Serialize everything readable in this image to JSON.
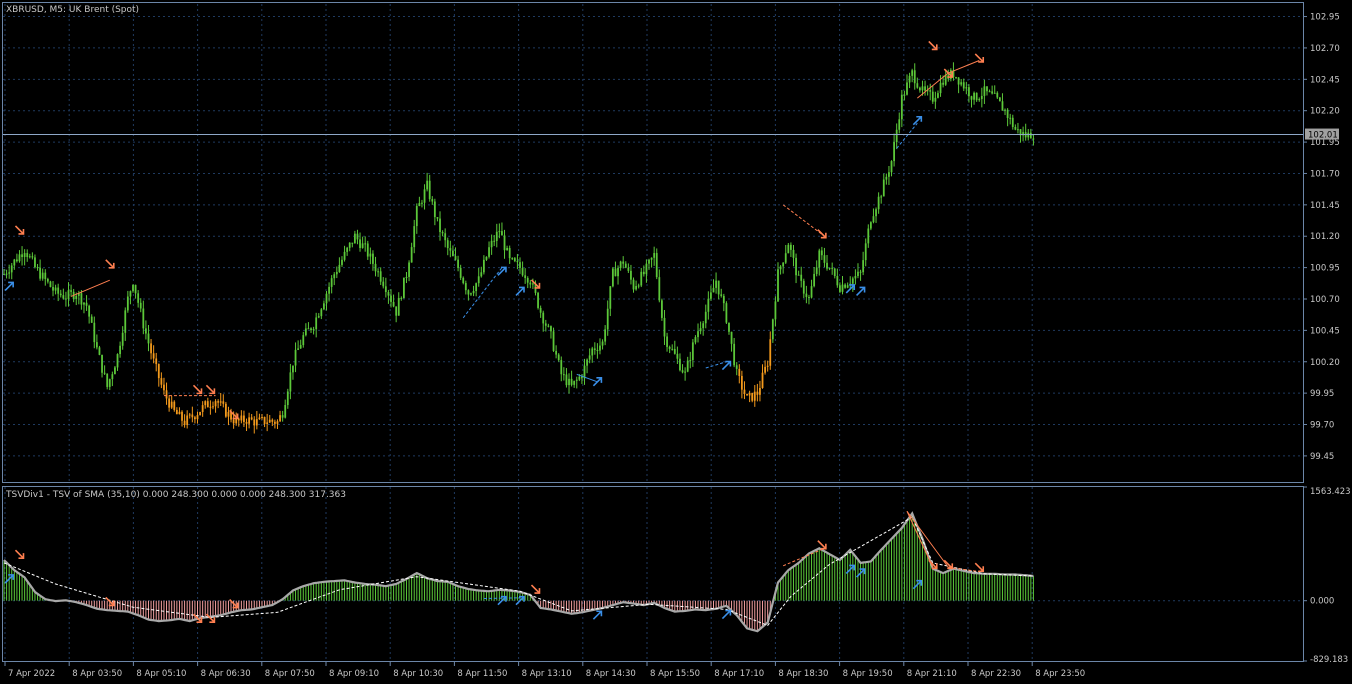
{
  "window": {
    "main_title": "XBRUSD, M5:  UK Brent (Spot)",
    "indicator_title": "TSVDiv1 - TSV of SMA (35,10) 0.000 248.300 0.000 0.000 248.300 317.363"
  },
  "colors": {
    "background": "#000000",
    "grid": "#1f3a5f",
    "frame": "#6c86a8",
    "candle_green": "#5cc839",
    "candle_orange": "#f39a1c",
    "histogram_green": "#5cc839",
    "histogram_red": "#f3a0a0",
    "tsv_line": "#a8a8a8",
    "signal_line": "#ffffff",
    "bear_arrow": "#ff7f50",
    "bull_arrow": "#3a8fe8",
    "price_line": "#8fa8c8"
  },
  "price_tag": "102.01",
  "chart_data": [
    {
      "type": "candlestick",
      "ylim": [
        99.25,
        103.05
      ],
      "y_ticks": [
        "102.95",
        "102.70",
        "102.45",
        "102.20",
        "101.95",
        "101.70",
        "101.45",
        "101.20",
        "100.95",
        "100.70",
        "100.45",
        "100.20",
        "99.95",
        "99.70",
        "99.45"
      ],
      "current_price": 102.01,
      "x_ticks": [
        "7 Apr 2022",
        "8 Apr 03:50",
        "8 Apr 05:10",
        "8 Apr 06:30",
        "8 Apr 07:50",
        "8 Apr 09:10",
        "8 Apr 10:30",
        "8 Apr 11:50",
        "8 Apr 13:10",
        "8 Apr 14:30",
        "8 Apr 15:50",
        "8 Apr 17:10",
        "8 Apr 18:30",
        "8 Apr 19:50",
        "8 Apr 21:10",
        "8 Apr 22:30",
        "8 Apr 23:50"
      ],
      "close_path": [
        [
          0,
          100.9
        ],
        [
          4,
          101.0
        ],
        [
          8,
          101.1
        ],
        [
          12,
          100.95
        ],
        [
          16,
          100.85
        ],
        [
          20,
          100.75
        ],
        [
          24,
          100.72
        ],
        [
          28,
          100.75
        ],
        [
          32,
          100.65
        ],
        [
          36,
          100.3
        ],
        [
          40,
          100.0
        ],
        [
          44,
          100.25
        ],
        [
          48,
          100.7
        ],
        [
          50,
          100.85
        ],
        [
          54,
          100.5
        ],
        [
          58,
          100.2
        ],
        [
          62,
          99.95
        ],
        [
          66,
          99.8
        ],
        [
          70,
          99.72
        ],
        [
          74,
          99.78
        ],
        [
          78,
          99.85
        ],
        [
          82,
          99.9
        ],
        [
          86,
          99.8
        ],
        [
          90,
          99.72
        ],
        [
          94,
          99.74
        ],
        [
          98,
          99.72
        ],
        [
          102,
          99.73
        ],
        [
          106,
          99.72
        ],
        [
          108,
          99.8
        ],
        [
          112,
          100.2
        ],
        [
          116,
          100.4
        ],
        [
          120,
          100.5
        ],
        [
          124,
          100.7
        ],
        [
          128,
          100.9
        ],
        [
          132,
          101.05
        ],
        [
          136,
          101.2
        ],
        [
          140,
          101.1
        ],
        [
          144,
          100.95
        ],
        [
          148,
          100.8
        ],
        [
          152,
          100.6
        ],
        [
          156,
          100.9
        ],
        [
          160,
          101.4
        ],
        [
          164,
          101.6
        ],
        [
          168,
          101.3
        ],
        [
          172,
          101.1
        ],
        [
          176,
          100.95
        ],
        [
          180,
          100.75
        ],
        [
          184,
          100.85
        ],
        [
          188,
          101.1
        ],
        [
          192,
          101.25
        ],
        [
          196,
          101.0
        ],
        [
          200,
          100.95
        ],
        [
          204,
          100.85
        ],
        [
          208,
          100.6
        ],
        [
          212,
          100.4
        ],
        [
          216,
          100.1
        ],
        [
          220,
          100.0
        ],
        [
          224,
          100.1
        ],
        [
          228,
          100.3
        ],
        [
          232,
          100.35
        ],
        [
          236,
          100.9
        ],
        [
          240,
          101.0
        ],
        [
          244,
          100.8
        ],
        [
          248,
          100.9
        ],
        [
          252,
          101.05
        ],
        [
          256,
          100.4
        ],
        [
          260,
          100.25
        ],
        [
          264,
          100.1
        ],
        [
          268,
          100.4
        ],
        [
          272,
          100.6
        ],
        [
          276,
          100.85
        ],
        [
          280,
          100.55
        ],
        [
          284,
          100.1
        ],
        [
          288,
          99.9
        ],
        [
          292,
          99.95
        ],
        [
          296,
          100.2
        ],
        [
          300,
          100.9
        ],
        [
          304,
          101.15
        ],
        [
          308,
          100.85
        ],
        [
          312,
          100.7
        ],
        [
          316,
          101.05
        ],
        [
          320,
          100.95
        ],
        [
          324,
          100.8
        ],
        [
          328,
          100.85
        ],
        [
          332,
          100.9
        ],
        [
          336,
          101.35
        ],
        [
          340,
          101.55
        ],
        [
          344,
          101.8
        ],
        [
          348,
          102.3
        ],
        [
          352,
          102.5
        ],
        [
          356,
          102.35
        ],
        [
          360,
          102.3
        ],
        [
          364,
          102.45
        ],
        [
          368,
          102.5
        ],
        [
          372,
          102.4
        ],
        [
          376,
          102.3
        ],
        [
          380,
          102.35
        ],
        [
          384,
          102.3
        ],
        [
          388,
          102.2
        ],
        [
          392,
          102.05
        ],
        [
          396,
          102.0
        ],
        [
          399,
          102.02
        ]
      ],
      "orange_segments": [
        [
          57,
          107
        ],
        [
          285,
          297
        ]
      ],
      "marks": [
        {
          "type": "bear",
          "x": 6,
          "y": 101.25
        },
        {
          "type": "bear",
          "x": 41,
          "y": 100.98
        },
        {
          "type": "bear",
          "x": 75,
          "y": 99.98
        },
        {
          "type": "bear",
          "x": 80,
          "y": 99.98
        },
        {
          "type": "bear",
          "x": 89,
          "y": 99.78
        },
        {
          "type": "bear",
          "x": 206,
          "y": 100.82
        },
        {
          "type": "bear",
          "x": 317,
          "y": 101.22
        },
        {
          "type": "bear",
          "x": 360,
          "y": 102.72
        },
        {
          "type": "bear",
          "x": 366,
          "y": 102.5
        },
        {
          "type": "bear",
          "x": 378,
          "y": 102.62
        },
        {
          "type": "bull",
          "x": 2,
          "y": 100.8
        },
        {
          "type": "bull",
          "x": 193,
          "y": 100.92
        },
        {
          "type": "bull",
          "x": 200,
          "y": 100.76
        },
        {
          "type": "bull",
          "x": 230,
          "y": 100.04
        },
        {
          "type": "bull",
          "x": 280,
          "y": 100.17
        },
        {
          "type": "bull",
          "x": 328,
          "y": 100.78
        },
        {
          "type": "bull",
          "x": 332,
          "y": 100.76
        },
        {
          "type": "bull",
          "x": 354,
          "y": 102.12
        }
      ],
      "div_lines": [
        {
          "type": "bear",
          "x1": 26,
          "y1": 100.72,
          "x2": 41,
          "y2": 100.85,
          "dashed": false
        },
        {
          "type": "bear",
          "x1": 62,
          "y1": 99.93,
          "x2": 82,
          "y2": 99.93,
          "dashed": true
        },
        {
          "type": "bear",
          "x1": 302,
          "y1": 101.45,
          "x2": 318,
          "y2": 101.2,
          "dashed": true
        },
        {
          "type": "bear",
          "x1": 354,
          "y1": 102.3,
          "x2": 366,
          "y2": 102.5,
          "dashed": false
        },
        {
          "type": "bear",
          "x1": 366,
          "y1": 102.5,
          "x2": 378,
          "y2": 102.6,
          "dashed": false
        },
        {
          "type": "bull",
          "x1": 178,
          "y1": 100.55,
          "x2": 193,
          "y2": 100.95,
          "dashed": true
        },
        {
          "type": "bull",
          "x1": 222,
          "y1": 100.1,
          "x2": 230,
          "y2": 100.04,
          "dashed": false
        },
        {
          "type": "bull",
          "x1": 272,
          "y1": 100.15,
          "x2": 280,
          "y2": 100.2,
          "dashed": true
        },
        {
          "type": "bull",
          "x1": 346,
          "y1": 101.9,
          "x2": 354,
          "y2": 102.1,
          "dashed": true
        }
      ]
    },
    {
      "type": "bar",
      "ylim": [
        -829.183,
        1563.423
      ],
      "y_ticks": [
        "1563.423",
        "0.000",
        "-829.183"
      ],
      "tsv_path": [
        [
          0,
          560
        ],
        [
          4,
          420
        ],
        [
          8,
          320
        ],
        [
          12,
          120
        ],
        [
          16,
          20
        ],
        [
          20,
          -5
        ],
        [
          24,
          5
        ],
        [
          28,
          -20
        ],
        [
          32,
          -60
        ],
        [
          36,
          -110
        ],
        [
          40,
          -130
        ],
        [
          44,
          -140
        ],
        [
          48,
          -150
        ],
        [
          52,
          -200
        ],
        [
          56,
          -260
        ],
        [
          60,
          -280
        ],
        [
          64,
          -270
        ],
        [
          68,
          -250
        ],
        [
          72,
          -280
        ],
        [
          76,
          -240
        ],
        [
          80,
          -220
        ],
        [
          84,
          -200
        ],
        [
          88,
          -160
        ],
        [
          92,
          -130
        ],
        [
          96,
          -120
        ],
        [
          100,
          -90
        ],
        [
          104,
          -60
        ],
        [
          108,
          20
        ],
        [
          112,
          140
        ],
        [
          116,
          200
        ],
        [
          120,
          240
        ],
        [
          124,
          260
        ],
        [
          128,
          270
        ],
        [
          132,
          280
        ],
        [
          136,
          250
        ],
        [
          140,
          230
        ],
        [
          144,
          220
        ],
        [
          148,
          200
        ],
        [
          152,
          230
        ],
        [
          156,
          300
        ],
        [
          160,
          380
        ],
        [
          164,
          310
        ],
        [
          168,
          270
        ],
        [
          172,
          260
        ],
        [
          176,
          200
        ],
        [
          180,
          160
        ],
        [
          184,
          140
        ],
        [
          188,
          130
        ],
        [
          192,
          150
        ],
        [
          196,
          140
        ],
        [
          200,
          120
        ],
        [
          204,
          80
        ],
        [
          208,
          -100
        ],
        [
          212,
          -120
        ],
        [
          216,
          -150
        ],
        [
          220,
          -180
        ],
        [
          224,
          -160
        ],
        [
          228,
          -130
        ],
        [
          232,
          -100
        ],
        [
          236,
          -60
        ],
        [
          240,
          -20
        ],
        [
          244,
          -40
        ],
        [
          248,
          -60
        ],
        [
          252,
          -30
        ],
        [
          256,
          -100
        ],
        [
          260,
          -150
        ],
        [
          264,
          -140
        ],
        [
          268,
          -120
        ],
        [
          272,
          -130
        ],
        [
          276,
          -110
        ],
        [
          280,
          -70
        ],
        [
          284,
          -200
        ],
        [
          288,
          -380
        ],
        [
          292,
          -420
        ],
        [
          296,
          -300
        ],
        [
          300,
          250
        ],
        [
          304,
          420
        ],
        [
          308,
          520
        ],
        [
          312,
          650
        ],
        [
          316,
          720
        ],
        [
          320,
          640
        ],
        [
          324,
          560
        ],
        [
          328,
          700
        ],
        [
          332,
          520
        ],
        [
          336,
          540
        ],
        [
          340,
          700
        ],
        [
          344,
          850
        ],
        [
          348,
          1000
        ],
        [
          352,
          1200
        ],
        [
          356,
          850
        ],
        [
          360,
          440
        ],
        [
          364,
          380
        ],
        [
          368,
          440
        ],
        [
          372,
          410
        ],
        [
          376,
          380
        ],
        [
          380,
          370
        ],
        [
          384,
          370
        ],
        [
          388,
          360
        ],
        [
          392,
          360
        ],
        [
          396,
          350
        ],
        [
          399,
          340
        ]
      ],
      "signal_path": [
        [
          0,
          520
        ],
        [
          20,
          230
        ],
        [
          50,
          -90
        ],
        [
          80,
          -230
        ],
        [
          106,
          -160
        ],
        [
          130,
          150
        ],
        [
          160,
          330
        ],
        [
          200,
          130
        ],
        [
          220,
          -140
        ],
        [
          250,
          -50
        ],
        [
          280,
          -120
        ],
        [
          296,
          -340
        ],
        [
          305,
          60
        ],
        [
          320,
          500
        ],
        [
          352,
          1150
        ],
        [
          360,
          520
        ],
        [
          380,
          370
        ],
        [
          399,
          340
        ]
      ],
      "marks": [
        {
          "type": "bear",
          "x": 6,
          "y": 640
        },
        {
          "type": "bear",
          "x": 41,
          "y": -10
        },
        {
          "type": "bear",
          "x": 75,
          "y": -240
        },
        {
          "type": "bear",
          "x": 80,
          "y": -240
        },
        {
          "type": "bear",
          "x": 89,
          "y": -40
        },
        {
          "type": "bear",
          "x": 206,
          "y": 160
        },
        {
          "type": "bear",
          "x": 317,
          "y": 770
        },
        {
          "type": "bear",
          "x": 360,
          "y": 500
        },
        {
          "type": "bear",
          "x": 366,
          "y": 500
        },
        {
          "type": "bear",
          "x": 378,
          "y": 460
        },
        {
          "type": "bull",
          "x": 2,
          "y": 300
        },
        {
          "type": "bull",
          "x": 193,
          "y": 0
        },
        {
          "type": "bull",
          "x": 200,
          "y": 0
        },
        {
          "type": "bull",
          "x": 230,
          "y": -200
        },
        {
          "type": "bull",
          "x": 280,
          "y": -190
        },
        {
          "type": "bull",
          "x": 328,
          "y": 430
        },
        {
          "type": "bull",
          "x": 332,
          "y": 380
        },
        {
          "type": "bull",
          "x": 354,
          "y": 220
        }
      ],
      "div_lines": [
        {
          "type": "bear",
          "x1": 302,
          "y1": 480,
          "x2": 318,
          "y2": 720,
          "dashed": true
        },
        {
          "type": "bear",
          "x1": 350,
          "y1": 1230,
          "x2": 360,
          "y2": 460,
          "dashed": false
        },
        {
          "type": "bear",
          "x1": 350,
          "y1": 1230,
          "x2": 366,
          "y2": 460,
          "dashed": false
        },
        {
          "type": "bear",
          "x1": 366,
          "y1": 460,
          "x2": 378,
          "y2": 400,
          "dashed": true
        },
        {
          "type": "bull",
          "x1": 186,
          "y1": 30,
          "x2": 200,
          "y2": 40,
          "dashed": true
        }
      ]
    }
  ]
}
